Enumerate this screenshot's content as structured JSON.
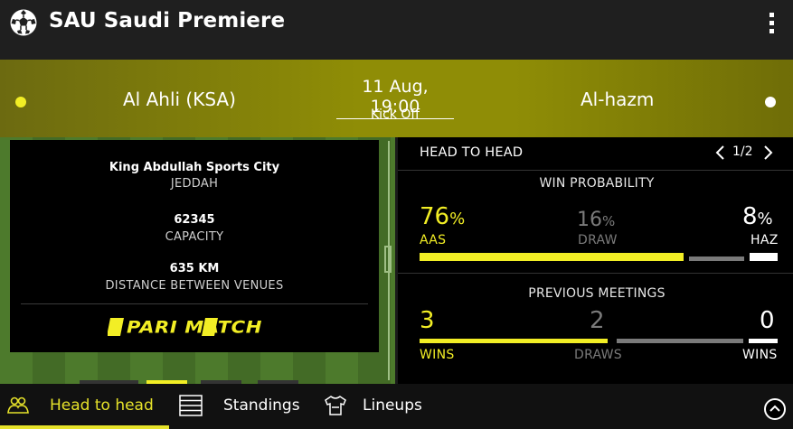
{
  "app": {
    "title": "SAU Saudi Premiere",
    "logo_icon": "soccer-ball-icon",
    "menu_icon": "vertical-ellipsis-icon"
  },
  "match": {
    "home_team": "Al Ahli (KSA)",
    "away_team": "Al-hazm",
    "date_time": "11 Aug, 19:00",
    "status": "Kick Off",
    "home_color": "#f2ee25",
    "away_color": "#ffffff"
  },
  "venue": {
    "stadium": "King Abdullah Sports City",
    "city": "JEDDAH",
    "capacity_value": "62345",
    "capacity_label": "CAPACITY",
    "distance_value": "635 KM",
    "distance_label": "DISTANCE BETWEEN VENUES",
    "sponsor": "PARIMATCH"
  },
  "head_to_head": {
    "title": "HEAD TO HEAD",
    "page": "1/2",
    "win_probability": {
      "title": "WIN PROBABILITY",
      "home_value": "76",
      "home_unit": "%",
      "home_label": "AAS",
      "draw_value": "16",
      "draw_unit": "%",
      "draw_label": "DRAW",
      "away_value": "8",
      "away_unit": "%",
      "away_label": "HAZ",
      "home_pct": 76,
      "draw_pct": 16,
      "away_pct": 8
    },
    "previous_meetings": {
      "title": "PREVIOUS MEETINGS",
      "home_wins": "3",
      "home_label": "WINS",
      "draws": "2",
      "draws_label": "DRAWS",
      "away_wins": "0",
      "away_label": "WINS"
    }
  },
  "colors": {
    "accent": "#e6e22a",
    "draw_gray": "#7a7a7a"
  },
  "tabs": [
    {
      "label": "Head to head",
      "icon": "users-icon",
      "active": true
    },
    {
      "label": "Standings",
      "icon": "table-icon",
      "active": false
    },
    {
      "label": "Lineups",
      "icon": "shirt-icon",
      "active": false
    }
  ],
  "scroll_icon": "chevron-up-icon"
}
